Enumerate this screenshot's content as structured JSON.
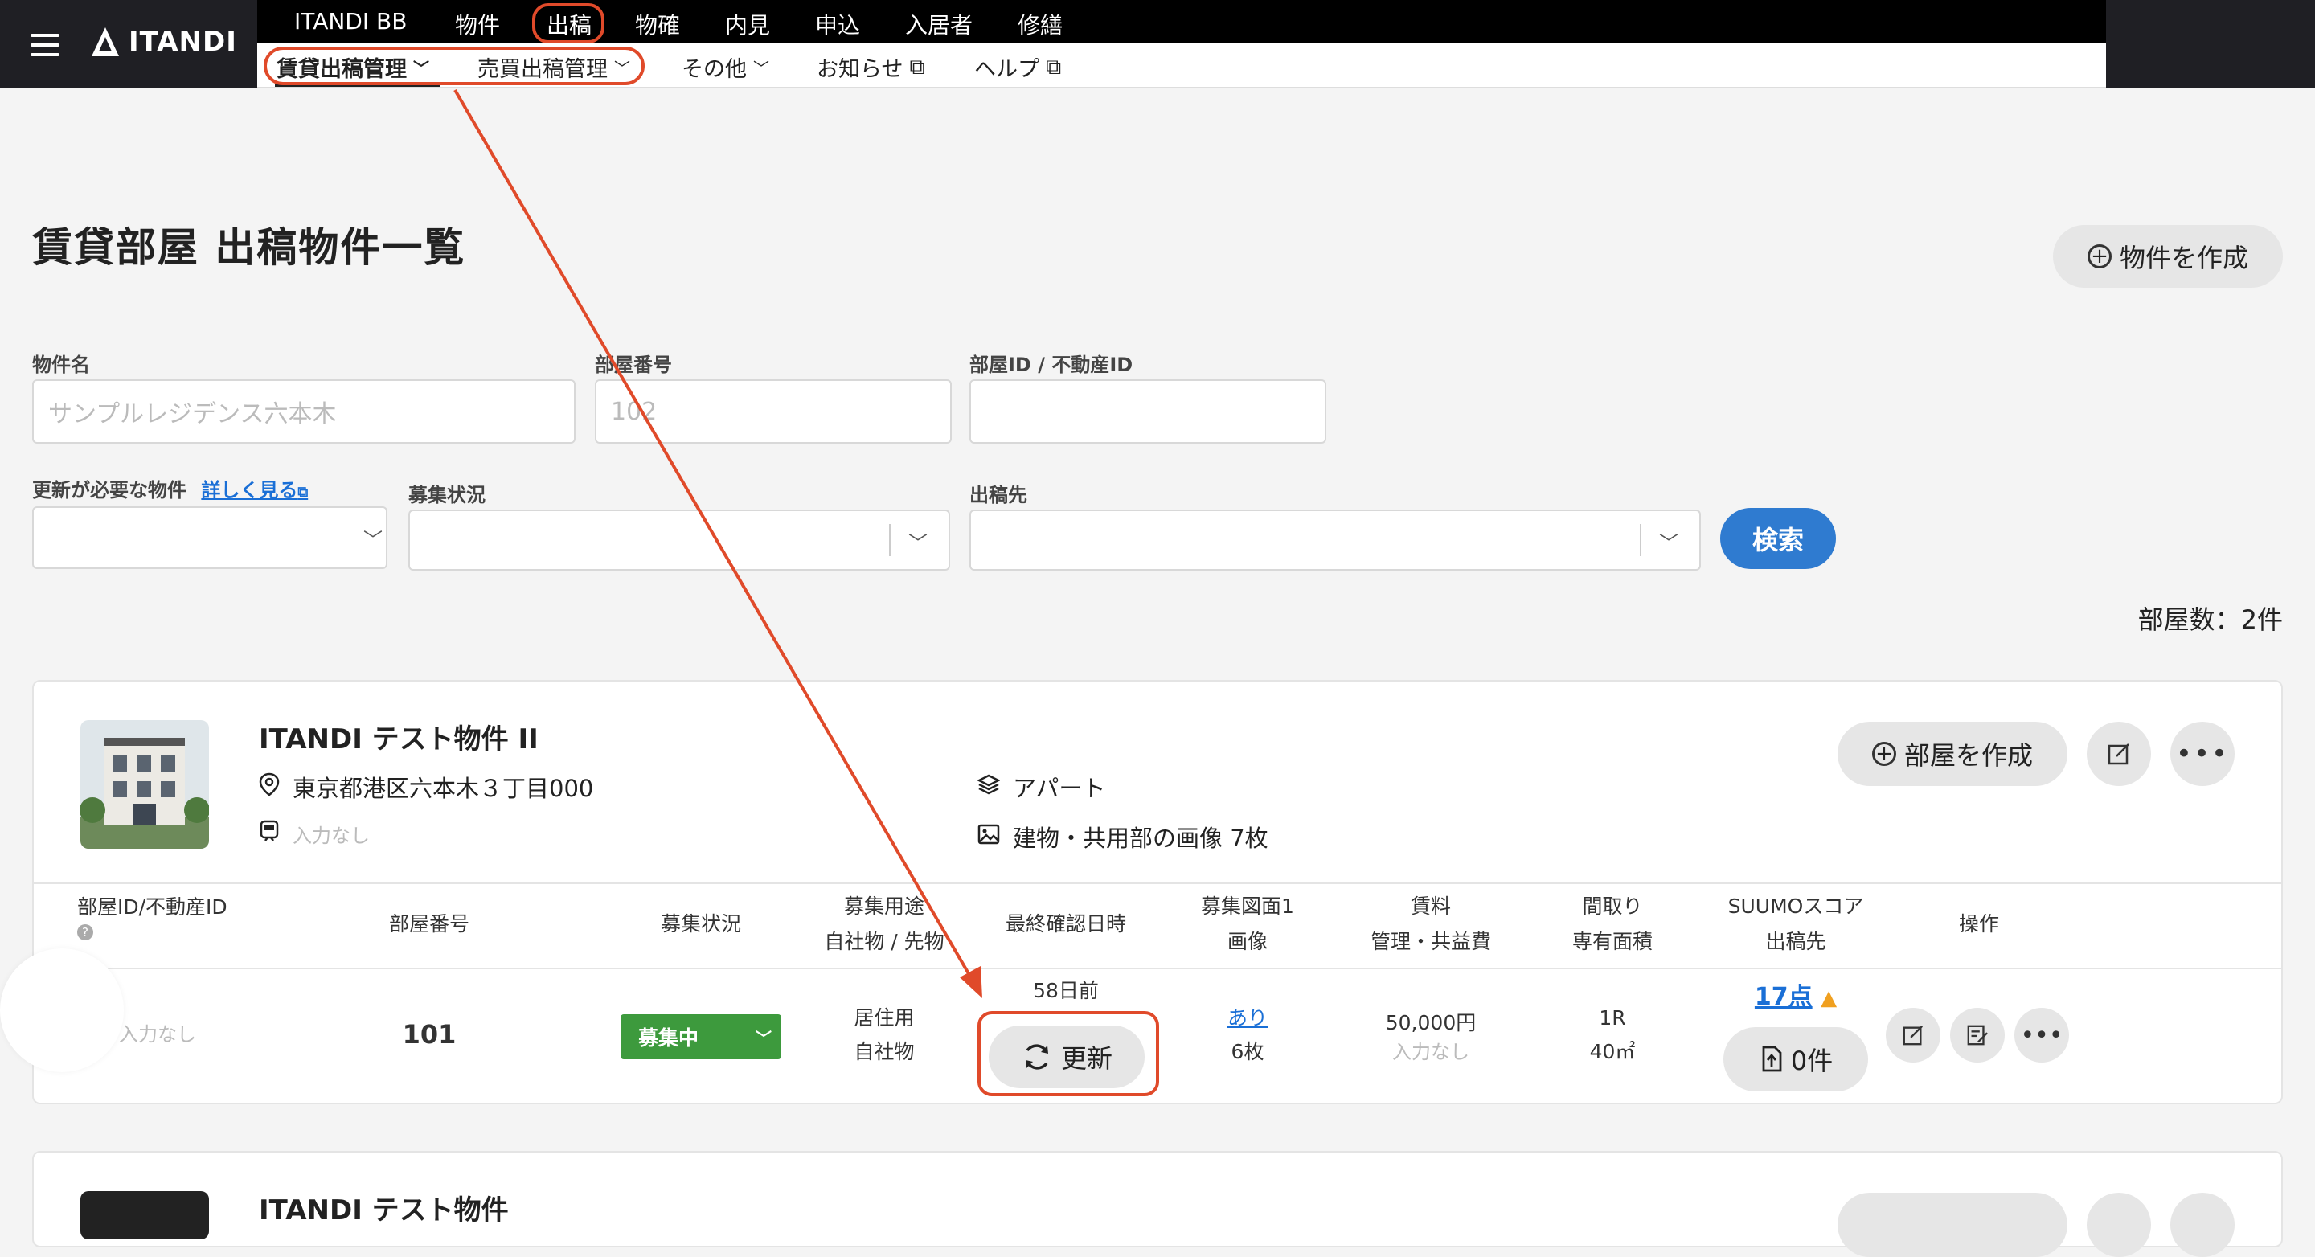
{
  "nav": {
    "logo": "ITANDI",
    "top_menu": [
      "ITANDI BB",
      "物件",
      "出稿",
      "物確",
      "内見",
      "申込",
      "入居者",
      "修繕"
    ],
    "sub_menu": {
      "rental": "賃貸出稿管理",
      "sales": "売買出稿管理",
      "other": "その他",
      "news": "お知らせ",
      "help": "ヘルプ"
    }
  },
  "page": {
    "title": "賃貸部屋 出稿物件一覧",
    "create_property": "物件を作成",
    "room_count": "部屋数：2件"
  },
  "filters": {
    "property_name_label": "物件名",
    "property_name_placeholder": "サンプルレジデンス六本木",
    "room_no_label": "部屋番号",
    "room_no_placeholder": "102",
    "room_id_label": "部屋ID / 不動産ID",
    "needs_update_label": "更新が必要な物件",
    "details_link": "詳しく見る",
    "recruit_status_label": "募集状況",
    "destination_label": "出稿先",
    "search_button": "検索"
  },
  "property1": {
    "name": "ITANDI テスト物件 II",
    "address": "東京都港区六本木３丁目000",
    "station": "入力なし",
    "type": "アパート",
    "images": "建物・共用部の画像 7枚",
    "create_room": "部屋を作成"
  },
  "table": {
    "headers": {
      "room_id": "部屋ID/不動産ID",
      "room_no": "部屋番号",
      "status": "募集状況",
      "usage_line1": "募集用途",
      "usage_line2": "自社物 / 先物",
      "last_confirm": "最終確認日時",
      "floorplan_line1": "募集図面1",
      "floorplan_line2": "画像",
      "rent_line1": "賃料",
      "rent_line2": "管理・共益費",
      "layout_line1": "間取り",
      "layout_line2": "専有面積",
      "suumo_line1": "SUUMOスコア",
      "suumo_line2": "出稿先",
      "ops": "操作"
    },
    "row": {
      "room_id": "入力なし",
      "room_no": "101",
      "status": "募集中",
      "usage_line1": "居住用",
      "usage_line2": "自社物",
      "days_ago": "58日前",
      "update": "更新",
      "floorplan_link": "あり",
      "floorplan_count": "6枚",
      "rent": "50,000円",
      "fee": "入力なし",
      "layout": "1R",
      "area": "40㎡",
      "suumo_score": "17点",
      "published_count": "0件"
    }
  },
  "property2": {
    "name": "ITANDI テスト物件"
  },
  "colors": {
    "annotation_red": "#e04a2a",
    "primary_blue": "#2f7bd0",
    "status_green": "#3d9a3d",
    "link_blue": "#1a6fd6",
    "warning": "#f0a020"
  }
}
